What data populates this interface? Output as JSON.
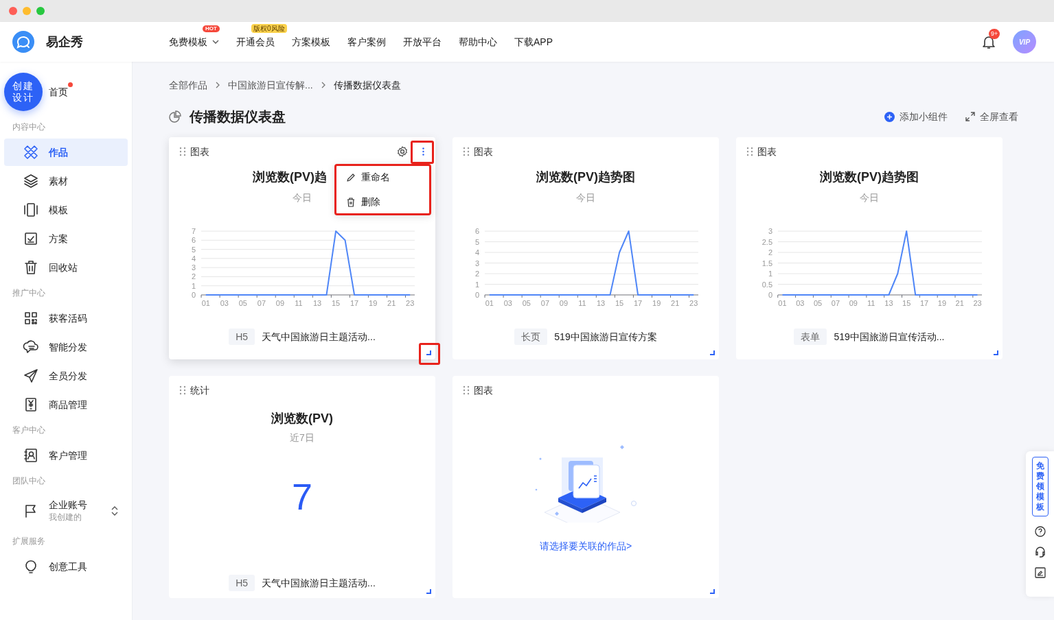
{
  "header": {
    "brand": "易企秀",
    "nav": [
      {
        "label": "免费模板",
        "badge": "HOT",
        "color": "#f5483b",
        "dropdown": true
      },
      {
        "label": "开通会员",
        "badge": "版权0风险",
        "color": "#fbd24c",
        "dropdown": false
      },
      {
        "label": "方案模板",
        "dropdown": false
      },
      {
        "label": "客户案例",
        "dropdown": false
      },
      {
        "label": "开放平台",
        "dropdown": false
      },
      {
        "label": "帮助中心",
        "dropdown": false
      },
      {
        "label": "下载APP",
        "dropdown": false
      }
    ],
    "notification_count": "9+",
    "avatar_label": "VIP"
  },
  "sidebar": {
    "create_button": "创建设计",
    "home": {
      "label": "首页",
      "unread": true
    },
    "sections": [
      {
        "title": "内容中心",
        "items": [
          {
            "label": "作品",
            "selected": true
          },
          {
            "label": "素材",
            "selected": false
          },
          {
            "label": "模板",
            "selected": false
          },
          {
            "label": "方案",
            "selected": false
          },
          {
            "label": "回收站",
            "selected": false
          }
        ]
      },
      {
        "title": "推广中心",
        "items": [
          {
            "label": "获客活码",
            "selected": false
          },
          {
            "label": "智能分发",
            "selected": false
          },
          {
            "label": "全员分发",
            "selected": false
          },
          {
            "label": "商品管理",
            "selected": false
          }
        ]
      },
      {
        "title": "客户中心",
        "items": [
          {
            "label": "客户管理",
            "selected": false
          }
        ]
      },
      {
        "title": "团队中心",
        "items": [
          {
            "label": "企业账号",
            "sublabel": "我创建的",
            "selected": false
          }
        ]
      },
      {
        "title": "扩展服务",
        "items": [
          {
            "label": "创意工具",
            "selected": false
          }
        ]
      }
    ]
  },
  "breadcrumb": [
    "全部作品",
    "中国旅游日宣传解...",
    "传播数据仪表盘"
  ],
  "page_title": "传播数据仪表盘",
  "actions": [
    {
      "kind": "add",
      "label": "添加小组件"
    },
    {
      "kind": "fullscreen",
      "label": "全屏查看"
    }
  ],
  "widgets": [
    {
      "kind": "chart",
      "type_label": "图表",
      "title": "浏览数(PV)趋",
      "subtitle": "今日",
      "hovered": true,
      "annotated": true,
      "menu_open": true,
      "menu": [
        {
          "kind": "rename",
          "label": "重命名"
        },
        {
          "kind": "delete",
          "label": "删除"
        }
      ],
      "tag": "H5",
      "work_title": "天气中国旅游日主题活动...",
      "chart_data": {
        "type": "line",
        "x": [
          1,
          2,
          3,
          4,
          5,
          6,
          7,
          8,
          9,
          10,
          11,
          12,
          13,
          14,
          15,
          16,
          17,
          18,
          19,
          20,
          21,
          22,
          23
        ],
        "xticks": [
          {
            "value": 1,
            "label": "01"
          },
          {
            "value": 3,
            "label": "03"
          },
          {
            "value": 5,
            "label": "05"
          },
          {
            "value": 7,
            "label": "07"
          },
          {
            "value": 9,
            "label": "09"
          },
          {
            "value": 11,
            "label": "11"
          },
          {
            "value": 13,
            "label": "13"
          },
          {
            "value": 15,
            "label": "15"
          },
          {
            "value": 17,
            "label": "17"
          },
          {
            "value": 19,
            "label": "19"
          },
          {
            "value": 21,
            "label": "21"
          },
          {
            "value": 23,
            "label": "23"
          }
        ],
        "xlim": [
          0.5,
          23.5
        ],
        "grid": true,
        "yticks": [
          0,
          1,
          2,
          3,
          4,
          5,
          6,
          7
        ],
        "ylim": [
          0,
          7
        ],
        "series": [
          {
            "color": "#4f86f7",
            "values": [
              0,
              0,
              0,
              0,
              0,
              0,
              0,
              0,
              0,
              0,
              0,
              0,
              0,
              0,
              7,
              6,
              0,
              0,
              0,
              0,
              0,
              0,
              0
            ]
          }
        ]
      }
    },
    {
      "kind": "chart",
      "type_label": "图表",
      "title": "浏览数(PV)趋势图",
      "subtitle": "今日",
      "hovered": false,
      "annotated": false,
      "menu_open": false,
      "tag": "长页",
      "work_title": "519中国旅游日宣传方案",
      "chart_data": {
        "type": "line",
        "x": [
          1,
          2,
          3,
          4,
          5,
          6,
          7,
          8,
          9,
          10,
          11,
          12,
          13,
          14,
          15,
          16,
          17,
          18,
          19,
          20,
          21,
          22,
          23
        ],
        "xticks": [
          {
            "value": 1,
            "label": "01"
          },
          {
            "value": 3,
            "label": "03"
          },
          {
            "value": 5,
            "label": "05"
          },
          {
            "value": 7,
            "label": "07"
          },
          {
            "value": 9,
            "label": "09"
          },
          {
            "value": 11,
            "label": "11"
          },
          {
            "value": 13,
            "label": "13"
          },
          {
            "value": 15,
            "label": "15"
          },
          {
            "value": 17,
            "label": "17"
          },
          {
            "value": 19,
            "label": "19"
          },
          {
            "value": 21,
            "label": "21"
          },
          {
            "value": 23,
            "label": "23"
          }
        ],
        "xlim": [
          0.5,
          23.5
        ],
        "grid": true,
        "yticks": [
          0,
          1,
          2,
          3,
          4,
          5,
          6
        ],
        "ylim": [
          0,
          6
        ],
        "series": [
          {
            "color": "#4f86f7",
            "values": [
              0,
              0,
              0,
              0,
              0,
              0,
              0,
              0,
              0,
              0,
              0,
              0,
              0,
              0,
              4,
              6,
              0,
              0,
              0,
              0,
              0,
              0,
              0
            ]
          }
        ]
      }
    },
    {
      "kind": "chart",
      "type_label": "图表",
      "title": "浏览数(PV)趋势图",
      "subtitle": "今日",
      "hovered": false,
      "annotated": false,
      "menu_open": false,
      "tag": "表单",
      "work_title": "519中国旅游日宣传活动...",
      "chart_data": {
        "type": "line",
        "x": [
          1,
          2,
          3,
          4,
          5,
          6,
          7,
          8,
          9,
          10,
          11,
          12,
          13,
          14,
          15,
          16,
          17,
          18,
          19,
          20,
          21,
          22,
          23
        ],
        "xticks": [
          {
            "value": 1,
            "label": "01"
          },
          {
            "value": 3,
            "label": "03"
          },
          {
            "value": 5,
            "label": "05"
          },
          {
            "value": 7,
            "label": "07"
          },
          {
            "value": 9,
            "label": "09"
          },
          {
            "value": 11,
            "label": "11"
          },
          {
            "value": 13,
            "label": "13"
          },
          {
            "value": 15,
            "label": "15"
          },
          {
            "value": 17,
            "label": "17"
          },
          {
            "value": 19,
            "label": "19"
          },
          {
            "value": 21,
            "label": "21"
          },
          {
            "value": 23,
            "label": "23"
          }
        ],
        "xlim": [
          0.5,
          23.5
        ],
        "grid": true,
        "yticks": [
          0,
          0.5,
          1,
          1.5,
          2,
          2.5,
          3
        ],
        "ylim": [
          0,
          3
        ],
        "series": [
          {
            "color": "#4f86f7",
            "values": [
              0,
              0,
              0,
              0,
              0,
              0,
              0,
              0,
              0,
              0,
              0,
              0,
              0,
              1,
              3,
              0,
              0,
              0,
              0,
              0,
              0,
              0,
              0
            ]
          }
        ]
      }
    },
    {
      "kind": "stat",
      "type_label": "统计",
      "title": "浏览数(PV)",
      "subtitle": "近7日",
      "value": "7",
      "tag": "H5",
      "work_title": "天气中国旅游日主题活动..."
    },
    {
      "kind": "empty",
      "type_label": "图表",
      "link": "请选择要关联的作品>"
    }
  ],
  "float_panel": {
    "promo_button": "免费领模板"
  }
}
